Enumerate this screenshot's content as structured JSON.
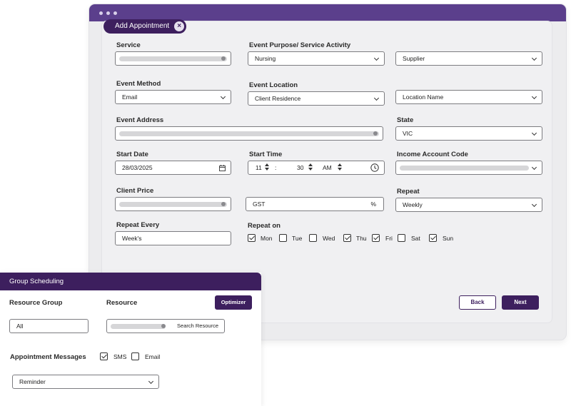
{
  "tab": {
    "title": "Add Appointment"
  },
  "form": {
    "service": {
      "label": "Service"
    },
    "event_purpose": {
      "label": "Event Purpose/ Service Activity",
      "value": "Nursing"
    },
    "supplier": {
      "value": "Supplier"
    },
    "event_method": {
      "label": "Event Method",
      "value": "Email"
    },
    "event_location": {
      "label": "Event Location",
      "value": "Client Residence"
    },
    "location_name": {
      "value": "Location Name"
    },
    "event_address": {
      "label": "Event Address"
    },
    "state": {
      "label": "State",
      "value": "VIC"
    },
    "start_date": {
      "label": "Start Date",
      "value": "28/03/2025"
    },
    "start_time": {
      "label": "Start Time",
      "hour": "11",
      "sep": ":",
      "minute": "30",
      "ampm": "AM"
    },
    "income_account_code": {
      "label": "Income Account Code"
    },
    "client_price": {
      "label": "Client Price"
    },
    "gst": {
      "value": "GST",
      "suffix": "%"
    },
    "repeat": {
      "label": "Repeat",
      "value": "Weekly"
    },
    "repeat_every": {
      "label": "Repeat Every",
      "value": "Week's"
    },
    "repeat_on": {
      "label": "Repeat on",
      "days": [
        {
          "label": "Mon",
          "checked": true
        },
        {
          "label": "Tue",
          "checked": false
        },
        {
          "label": "Wed",
          "checked": false
        },
        {
          "label": "Thu",
          "checked": true
        },
        {
          "label": "Fri",
          "checked": true
        },
        {
          "label": "Sat",
          "checked": false
        },
        {
          "label": "Sun",
          "checked": true
        }
      ]
    },
    "buttons": {
      "back": "Back",
      "next": "Next"
    }
  },
  "group_scheduling": {
    "title": "Group Scheduling",
    "resource_group": {
      "label": "Resource Group",
      "value": "All"
    },
    "resource": {
      "label": "Resource",
      "search_label": "Search Resource"
    },
    "optimizer_button": "Optimizer",
    "appointment_messages": {
      "label": "Appointment Messages",
      "sms": {
        "label": "SMS",
        "checked": true
      },
      "email": {
        "label": "Email",
        "checked": false
      }
    },
    "message_type": {
      "value": "Reminder"
    }
  },
  "colors": {
    "accent": "#3d1f5e",
    "window_bar": "#5b3f8c"
  }
}
